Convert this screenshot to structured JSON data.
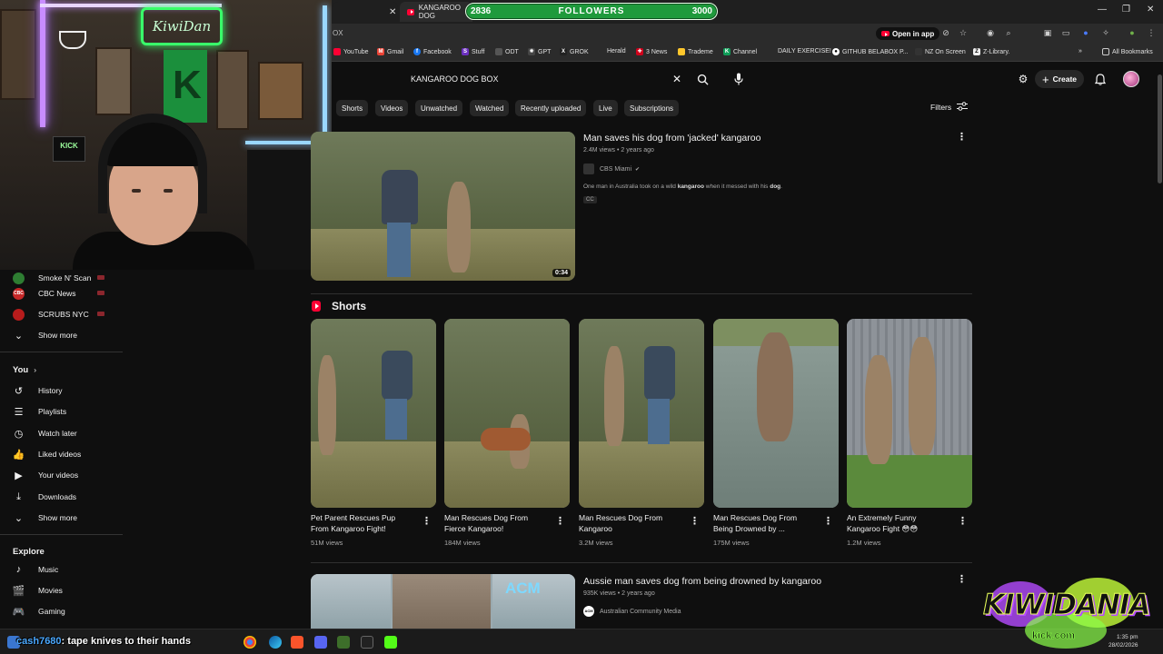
{
  "browser": {
    "active_tab_title": "KANGAROO DOG",
    "url_fragment": "OX",
    "open_in_app_label": "Open in app",
    "all_bookmarks_label": "All Bookmarks",
    "bookmarks": [
      "YouTube",
      "Gmail",
      "Facebook",
      "Stuff",
      "ODT",
      "GPT",
      "GROK",
      "Herald",
      "3 News",
      "Trademe",
      "Channel",
      "DAILY EXERCISE!",
      "GITHUB BELABOX P...",
      "NZ On Screen",
      "Z-Library."
    ]
  },
  "followers_goal": {
    "label": "FOLLOWERS",
    "current": "2836",
    "target": "3000",
    "progress": 0.9453
  },
  "webcam": {
    "sign_text": "KiwiDan",
    "kick_label": "KICK"
  },
  "search": {
    "query": "KANGAROO DOG BOX"
  },
  "header": {
    "create_label": "Create"
  },
  "chips": [
    "Shorts",
    "Videos",
    "Unwatched",
    "Watched",
    "Recently uploaded",
    "Live",
    "Subscriptions"
  ],
  "filters_label": "Filters",
  "sidebar": {
    "subscriptions": [
      {
        "name": "Smoke N' Scan",
        "avatar_color": "#2e7d32"
      },
      {
        "name": "CBC News",
        "avatar_color": "#c62828"
      },
      {
        "name": "SCRUBS NYC",
        "avatar_color": "#b71c1c"
      }
    ],
    "show_more_1": "Show more",
    "you_heading": "You",
    "you_items": [
      "History",
      "Playlists",
      "Watch later",
      "Liked videos",
      "Your videos",
      "Downloads"
    ],
    "show_more_2": "Show more",
    "explore_heading": "Explore",
    "explore_items": [
      "Music",
      "Movies",
      "Gaming"
    ]
  },
  "results": [
    {
      "title": "Man saves his dog from 'jacked' kangaroo",
      "views": "2.4M views",
      "age": "2 years ago",
      "channel": "CBS Miami",
      "description_before": "One man in Australia took on a wild ",
      "description_bold1": "kangaroo",
      "description_mid": " when it messed with his ",
      "description_bold2": "dog",
      "description_end": ".",
      "badge": "CC",
      "duration": "0:34"
    },
    {
      "title": "Aussie man saves dog from being drowned by kangaroo",
      "views": "935K views",
      "age": "2 years ago",
      "channel": "Australian Community Media",
      "thumb_logo": "ACM"
    }
  ],
  "shorts_section": {
    "heading": "Shorts",
    "items": [
      {
        "title_line1": "Pet Parent Rescues Pup",
        "title_line2": "From Kangaroo Fight!",
        "views": "51M views"
      },
      {
        "title_line1": "Man Rescues Dog From",
        "title_line2": "Fierce Kangaroo!",
        "views": "184M views"
      },
      {
        "title_line1": "Man Rescues Dog From",
        "title_line2": "Kangaroo",
        "views": "3.2M views"
      },
      {
        "title_line1": "Man Rescues Dog From",
        "title_line2": "Being Drowned by ...",
        "views": "175M views"
      },
      {
        "title_line1": "An Extremely Funny",
        "title_line2": "Kangaroo Fight 😳😳",
        "views": "1.2M views"
      }
    ]
  },
  "overlay_chat": {
    "username": "cash7680",
    "message": "tape knives to their hands"
  },
  "taskbar": {
    "time": "1:35 pm",
    "date": "28/02/2026"
  },
  "stream_logo": {
    "text": "KIWIDANIA",
    "sub": "kick.com"
  },
  "colors": {
    "accent_red": "#ff0033",
    "follower_green": "#1f9a3c",
    "bg": "#0f0f0f",
    "chip_bg": "#272727"
  }
}
